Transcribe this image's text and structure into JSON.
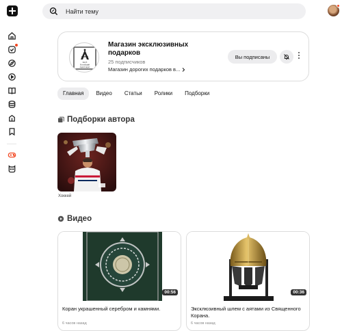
{
  "search": {
    "placeholder": "Найти тему"
  },
  "rail": {
    "items": [
      "home-icon",
      "notifications-icon",
      "discover-icon",
      "videos-icon",
      "articles-icon",
      "subscriptions-icon",
      "leaderboard-icon",
      "bookmarks-icon",
      "games-icon",
      "kids-icon"
    ]
  },
  "channel": {
    "logo_text_line1": "Клуб",
    "logo_text_line2": "Коллекций",
    "logo_text_line3": "Аристократ",
    "title": "Магазин эксклюзивных подарков",
    "subscribers": "25 подписчиков",
    "description": "Магазин дорогих подарков в...",
    "subscribed_label": "Вы подписаны"
  },
  "tabs": [
    {
      "label": "Главная",
      "active": true
    },
    {
      "label": "Видео",
      "active": false
    },
    {
      "label": "Статьи",
      "active": false
    },
    {
      "label": "Ролики",
      "active": false
    },
    {
      "label": "Подборки",
      "active": false
    }
  ],
  "collections_section": {
    "title": "Подборки автора",
    "items": [
      {
        "label": "Хоккей"
      }
    ]
  },
  "videos_section": {
    "title": "Видео",
    "items": [
      {
        "title": "Коран украшенный серебром и камнями.",
        "duration": "00:56",
        "time": "6 часов назад"
      },
      {
        "title": "Эксклюзивный шлем с аятами из Священного Корана.",
        "duration": "00:36",
        "time": "6 часов назад"
      }
    ]
  },
  "colors": {
    "accent": "#f24822",
    "surface": "#f0f0f2",
    "border": "#dcdcdc"
  }
}
